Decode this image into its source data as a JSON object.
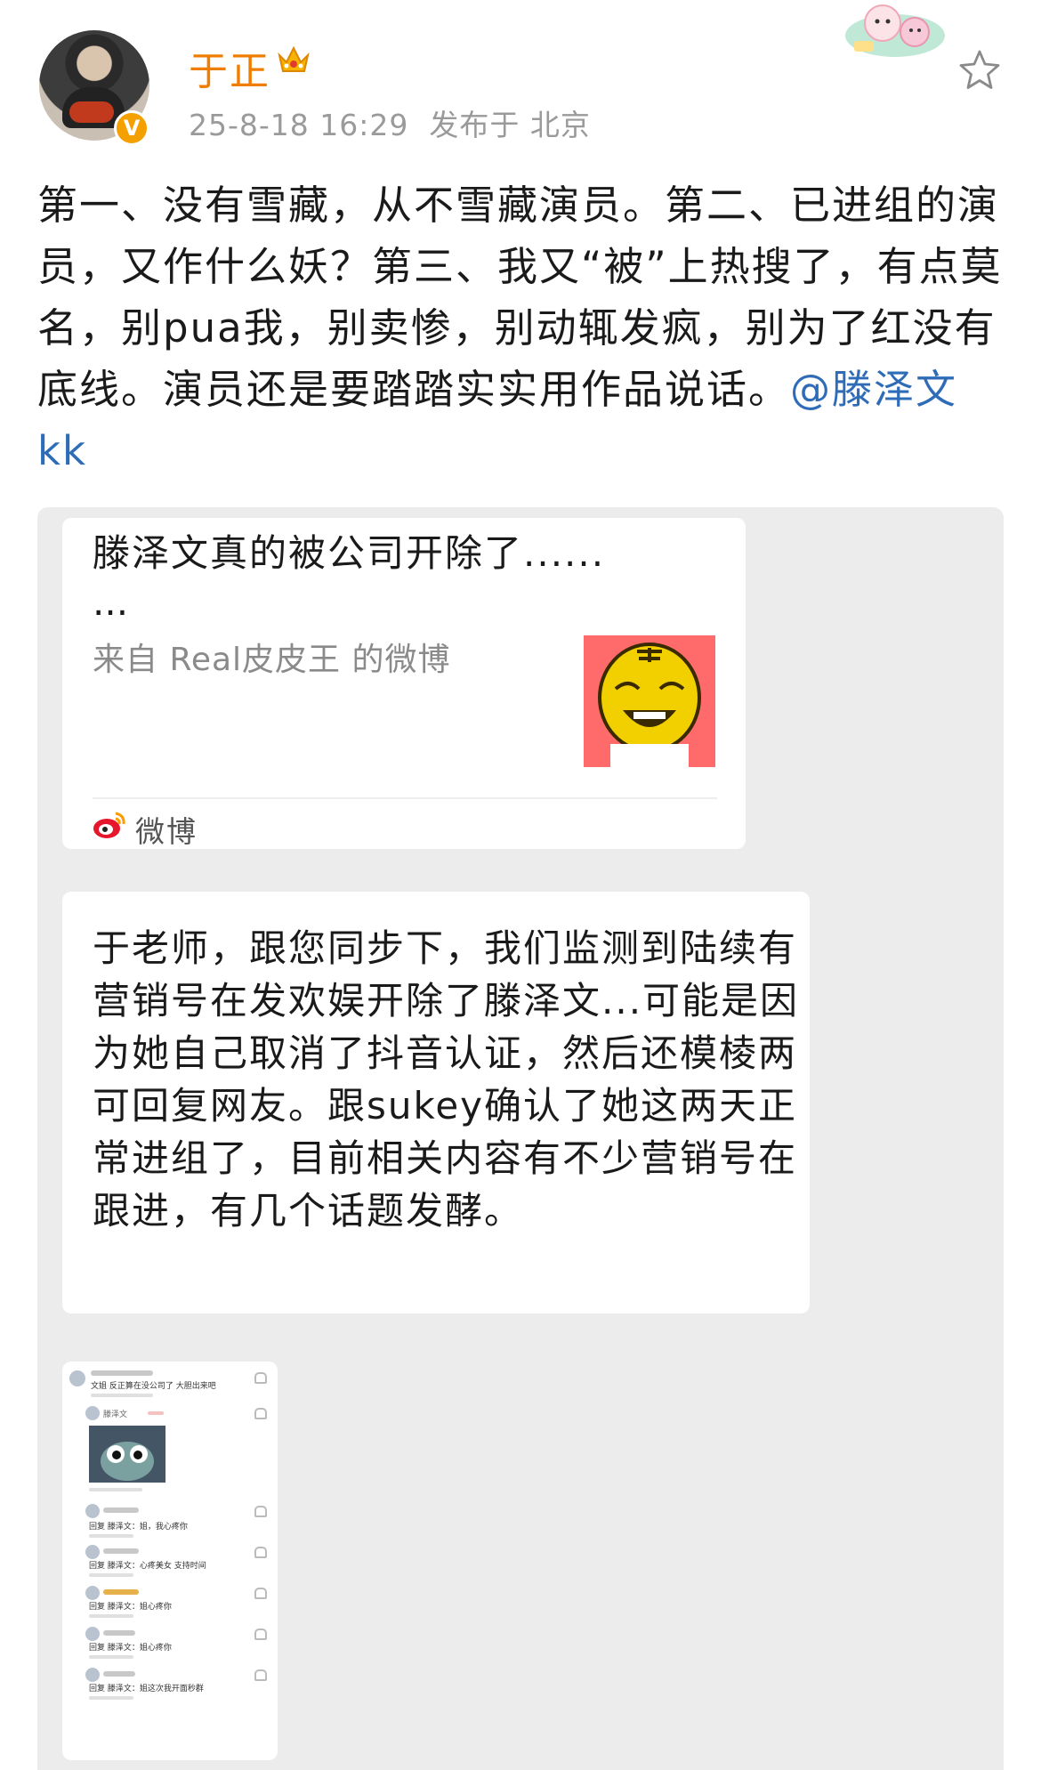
{
  "header": {
    "username": "于正",
    "verified_badge": "V",
    "timestamp": "25-8-18 16:29",
    "location_prefix": "发布于",
    "location": "北京"
  },
  "post": {
    "text": "第一、没有雪藏，从不雪藏演员。第二、已进组的演员，又作什么妖？第三、我又“被”上热搜了，有点莫名，别pua我，别卖惨，别动辄发疯，别为了红没有底线。演员还是要踏踏实实用作品说话。",
    "mention": "@滕泽文kk"
  },
  "shared_card": {
    "title": "滕泽文真的被公司开除了......",
    "title_continued": "...",
    "source": "来自 Real皮皮王 的微博",
    "brand": "微博"
  },
  "chat_message": {
    "text": "于老师，跟您同步下，我们监测到陆续有营销号在发欢娱开除了滕泽文...可能是因为她自己取消了抖音认证，然后还模棱两可回复网友。跟sukey确认了她这两天正常进组了，目前相关内容有不少营销号在跟进，有几个话题发酵。"
  },
  "screenshot_comments": {
    "top_comment": "文姐 反正算在没公司了 大胆出来吧",
    "reply_author": "滕泽文",
    "replies": [
      "回复 滕泽文：姐，我心疼你",
      "回复 滕泽文：心疼美女 支持时间",
      "回复 滕泽文：姐心疼你",
      "回复 滕泽文：姐心疼你",
      "回复 滕泽文：姐这次我开面秒群"
    ]
  },
  "icons": {
    "crown": "crown-icon",
    "star": "star-icon",
    "weibo": "weibo-logo-icon"
  },
  "colors": {
    "username": "#ef7d00",
    "mention": "#2e6cb8",
    "meta": "#9a9a9a",
    "panel_bg": "#ececec",
    "badge": "#f4a000"
  }
}
